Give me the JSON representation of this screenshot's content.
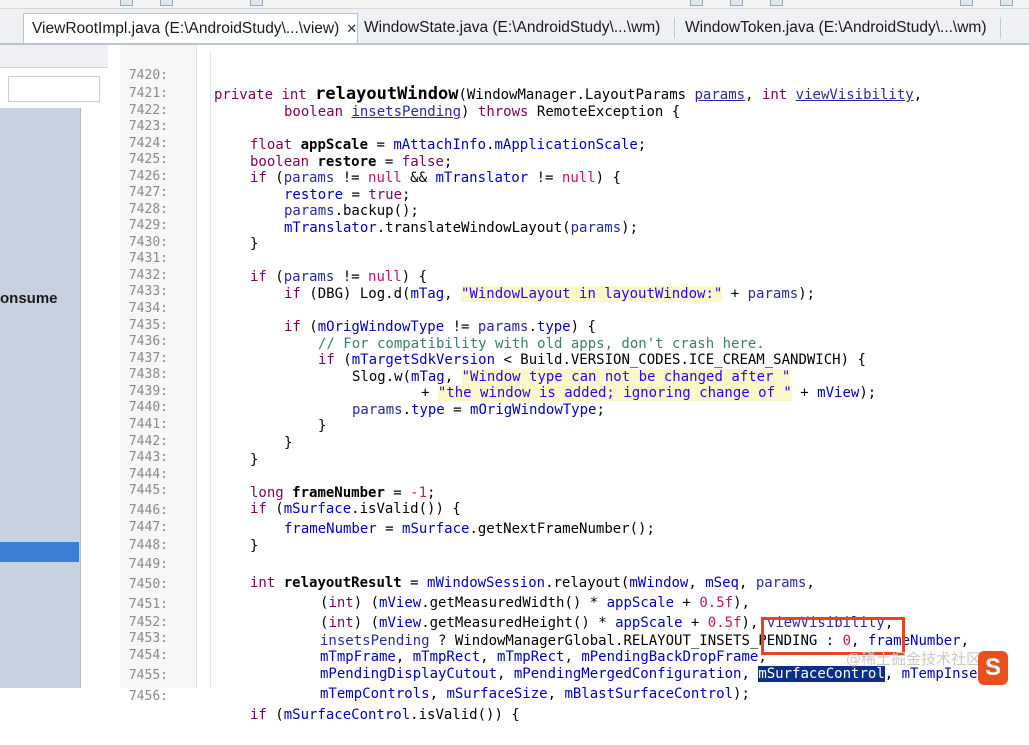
{
  "tabs": [
    {
      "label": "ViewRootImpl.java (E:\\AndroidStudy\\...\\view)",
      "close": "✕",
      "active": true
    },
    {
      "label": "WindowState.java (E:\\AndroidStudy\\...\\wm)",
      "active": false
    },
    {
      "label": "WindowToken.java (E:\\AndroidStudy\\...\\wm)",
      "active": false
    }
  ],
  "outline": {
    "partial_label": "onsume"
  },
  "watermark": "@稀土掘金技术社区",
  "logo_glyph": "S",
  "code_lines": [
    {
      "n": "7420:"
    },
    {
      "n": "7421:"
    },
    {
      "n": "7422:"
    },
    {
      "n": "7423:"
    },
    {
      "n": "7424:"
    },
    {
      "n": "7425:"
    },
    {
      "n": "7426:"
    },
    {
      "n": "7427:"
    },
    {
      "n": "7428:"
    },
    {
      "n": "7429:"
    },
    {
      "n": "7430:"
    },
    {
      "n": "7431:"
    },
    {
      "n": "7432:"
    },
    {
      "n": "7433:"
    },
    {
      "n": "7434:"
    },
    {
      "n": "7435:"
    },
    {
      "n": "7436:"
    },
    {
      "n": "7437:"
    },
    {
      "n": "7438:"
    },
    {
      "n": "7439:"
    },
    {
      "n": "7440:"
    },
    {
      "n": "7441:"
    },
    {
      "n": "7442:"
    },
    {
      "n": "7443:"
    },
    {
      "n": "7444:"
    },
    {
      "n": "7445:"
    },
    {
      "n": "7446:"
    },
    {
      "n": "7447:"
    },
    {
      "n": "7448:"
    },
    {
      "n": "7449:"
    },
    {
      "n": "7450:"
    },
    {
      "n": "7451:"
    },
    {
      "n": "7452:"
    },
    {
      "n": "7453:"
    },
    {
      "n": "7454:"
    },
    {
      "n": "7455:"
    },
    {
      "n": "7456:"
    }
  ],
  "code": {
    "l7420": {
      "kw1": "private",
      "kw2": "int",
      "method": "relayoutWindow",
      "t1": "(WindowManager.LayoutParams ",
      "p1": "params",
      "t2": ", ",
      "kw3": "int",
      "t3": " ",
      "p2": "viewVisibility",
      "t4": ","
    },
    "l7421": {
      "kw1": "boolean",
      "t1": " ",
      "p1": "insetsPending",
      "t2": ") ",
      "kw2": "throws",
      "t3": " RemoteException {"
    },
    "l7423": {
      "kw1": "float",
      "t1": " ",
      "v1": "appScale",
      "t2": " = ",
      "f1": "mAttachInfo",
      "t3": ".",
      "f2": "mApplicationScale",
      "t4": ";"
    },
    "l7424": {
      "kw1": "boolean",
      "t1": " ",
      "v1": "restore",
      "t2": " = ",
      "kw2": "false",
      "t3": ";"
    },
    "l7425": {
      "kw1": "if",
      "t1": " (",
      "p1": "params",
      "t2": " != ",
      "n1": "null",
      "t3": " && ",
      "f1": "mTranslator",
      "t4": " != ",
      "n2": "null",
      "t5": ") {"
    },
    "l7426": {
      "v1": "restore",
      "t1": " = ",
      "kw1": "true",
      "t2": ";"
    },
    "l7427": {
      "p1": "params",
      "t1": ".backup();"
    },
    "l7428": {
      "f1": "mTranslator",
      "t1": ".translateWindowLayout(",
      "p1": "params",
      "t2": ");"
    },
    "l7429": {
      "t1": "}"
    },
    "l7431": {
      "kw1": "if",
      "t1": " (",
      "p1": "params",
      "t2": " != ",
      "n1": "null",
      "t3": ") {"
    },
    "l7432": {
      "kw1": "if",
      "t1": " (DBG) Log.d(",
      "f1": "mTag",
      "t2": ", ",
      "s1": "\"WindowLayout in layoutWindow:\"",
      "t3": " + ",
      "p1": "params",
      "t4": ");"
    },
    "l7434": {
      "kw1": "if",
      "t1": " (",
      "f1": "mOrigWindowType",
      "t2": " != ",
      "p1": "params",
      "t3": ".",
      "f2": "type",
      "t4": ") {"
    },
    "l7435": {
      "c1": "// For compatibility with old apps, don't crash here."
    },
    "l7436": {
      "kw1": "if",
      "t1": " (",
      "f1": "mTargetSdkVersion",
      "t2": " < Build.VERSION_CODES.ICE_CREAM_SANDWICH) {"
    },
    "l7437": {
      "t1": "Slog.w(",
      "f1": "mTag",
      "t2": ", ",
      "s1": "\"Window type can not be changed after \""
    },
    "l7438": {
      "t1": "+ ",
      "s1": "\"the window is added; ignoring change of \"",
      "t2": " + ",
      "f1": "mView",
      "t3": ");"
    },
    "l7439": {
      "p1": "params",
      "t1": ".",
      "f1": "type",
      "t2": " = ",
      "f2": "mOrigWindowType",
      "t3": ";"
    },
    "l7440": {
      "t1": "}"
    },
    "l7441": {
      "t1": "}"
    },
    "l7442": {
      "t1": "}"
    },
    "l7444": {
      "kw1": "long",
      "t1": " ",
      "v1": "frameNumber",
      "t2": " = ",
      "n1": "-1",
      "t3": ";"
    },
    "l7445": {
      "kw1": "if",
      "t1": " (",
      "f1": "mSurface",
      "t2": ".isValid()) {"
    },
    "l7446": {
      "v1": "frameNumber",
      "t1": " = ",
      "f1": "mSurface",
      "t2": ".getNextFrameNumber();"
    },
    "l7447": {
      "t1": "}"
    },
    "l7449": {
      "kw1": "int",
      "t1": " ",
      "v1": "relayoutResult",
      "t2": " = ",
      "f1": "mWindowSession",
      "t3": ".relayout(",
      "f2": "mWindow",
      "t4": ", ",
      "f3": "mSeq",
      "t5": ", ",
      "p1": "params",
      "t6": ","
    },
    "l7450": {
      "t1": "(",
      "kw1": "int",
      "t2": ") (",
      "f1": "mView",
      "t3": ".getMeasuredWidth() * ",
      "v1": "appScale",
      "t4": " + ",
      "n1": "0.5f",
      "t5": "),"
    },
    "l7451": {
      "t1": "(",
      "kw1": "int",
      "t2": ") (",
      "f1": "mView",
      "t3": ".getMeasuredHeight() * ",
      "v1": "appScale",
      "t4": " + ",
      "n1": "0.5f",
      "t5": "), ",
      "p1": "viewVisibility",
      "t6": ","
    },
    "l7452": {
      "p1": "insetsPending",
      "t1": " ? WindowManagerGlobal.RELAYOUT_INSETS_PENDING : ",
      "n1": "0",
      "t2": ", ",
      "v1": "frameNumber",
      "t3": ","
    },
    "l7453": {
      "f1": "mTmpFrame",
      "t1": ", ",
      "f2": "mTmpRect",
      "t2": ", ",
      "f3": "mTmpRect",
      "t3": ", ",
      "f4": "mPendingBackDropFrame",
      "t4": ","
    },
    "l7454": {
      "f1": "mPendingDisplayCutout",
      "t1": ", ",
      "f2": "mPendingMergedConfiguration",
      "t2": ", ",
      "sel": "mSurfaceControl",
      "t3": ", ",
      "f3": "mTempInsets",
      "t4": ","
    },
    "l7455": {
      "f1": "mTempControls",
      "t1": ", ",
      "f2": "mSurfaceSize",
      "t2": ", ",
      "f3": "mBlastSurfaceControl",
      "t3": ");"
    },
    "l7456": {
      "kw1": "if",
      "t1": " (",
      "f1": "mSurfaceControl",
      "t2": ".isValid()) {"
    }
  }
}
